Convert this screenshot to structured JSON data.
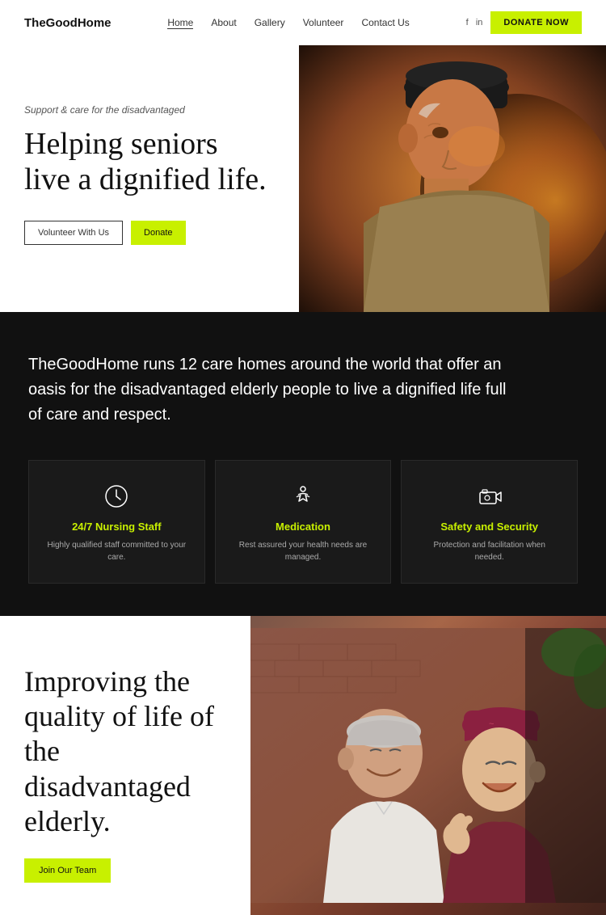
{
  "nav": {
    "logo": "TheGoodHome",
    "links": [
      {
        "label": "Home",
        "active": true
      },
      {
        "label": "About",
        "active": false
      },
      {
        "label": "Gallery",
        "active": false
      },
      {
        "label": "Volunteer",
        "active": false
      },
      {
        "label": "Contact Us",
        "active": false
      }
    ],
    "social": "f  in",
    "donate_btn": "DONATE NOW"
  },
  "hero": {
    "subtitle": "Support & care for the disadvantaged",
    "title": "Helping seniors live a dignified life.",
    "btn_volunteer": "Volunteer With Us",
    "btn_donate": "Donate"
  },
  "mission": {
    "text": "TheGoodHome runs 12 care homes around the world that offer an oasis for the disadvantaged elderly people to live a dignified life full of care and respect."
  },
  "features": [
    {
      "icon": "clock",
      "title": "24/7 Nursing Staff",
      "desc": "Highly qualified staff committed to your care."
    },
    {
      "icon": "person",
      "title": "Medication",
      "desc": "Rest assured your health needs are managed."
    },
    {
      "icon": "security",
      "title": "Safety and Security",
      "desc": "Protection and facilitation when needed."
    }
  ],
  "quality": {
    "title": "Improving the quality of life of the disadvantaged elderly.",
    "btn": "Join Our Team"
  }
}
